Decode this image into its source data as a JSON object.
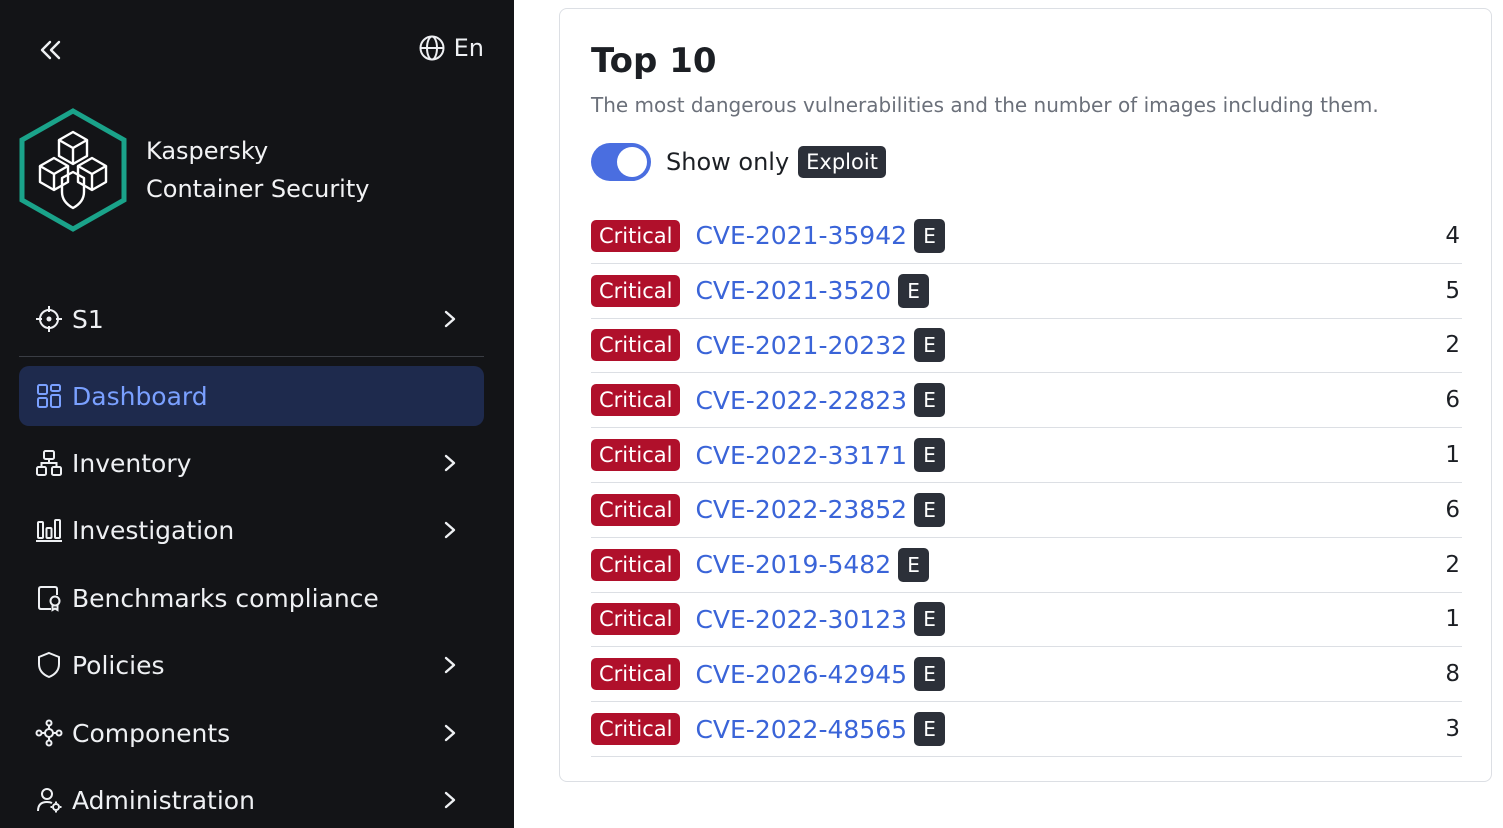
{
  "sidebar": {
    "language": "En",
    "brand_line1": "Kaspersky",
    "brand_line2": "Container Security",
    "scope": "S1",
    "items": [
      {
        "label": "Dashboard",
        "icon": "dashboard-icon",
        "active": true
      },
      {
        "label": "Inventory",
        "icon": "inventory-icon"
      },
      {
        "label": "Investigation",
        "icon": "investigation-icon"
      },
      {
        "label": "Benchmarks compliance",
        "icon": "benchmark-icon"
      },
      {
        "label": "Policies",
        "icon": "shield-icon"
      },
      {
        "label": "Components",
        "icon": "components-icon"
      },
      {
        "label": "Administration",
        "icon": "admin-icon"
      }
    ]
  },
  "card": {
    "title": "Top 10",
    "subtitle": "The most dangerous vulnerabilities and the number of images including them.",
    "toggle_label": "Show only",
    "toggle_on": true,
    "exploit_badge": "Exploit",
    "rows": [
      {
        "severity": "Critical",
        "cve": "CVE-2021-35942",
        "badge": "E",
        "count": "4"
      },
      {
        "severity": "Critical",
        "cve": "CVE-2021-3520",
        "badge": "E",
        "count": "5"
      },
      {
        "severity": "Critical",
        "cve": "CVE-2021-20232",
        "badge": "E",
        "count": "2"
      },
      {
        "severity": "Critical",
        "cve": "CVE-2022-22823",
        "badge": "E",
        "count": "6"
      },
      {
        "severity": "Critical",
        "cve": "CVE-2022-33171",
        "badge": "E",
        "count": "1"
      },
      {
        "severity": "Critical",
        "cve": "CVE-2022-23852",
        "badge": "E",
        "count": "6"
      },
      {
        "severity": "Critical",
        "cve": "CVE-2019-5482",
        "badge": "E",
        "count": "2"
      },
      {
        "severity": "Critical",
        "cve": "CVE-2022-30123",
        "badge": "E",
        "count": "1"
      },
      {
        "severity": "Critical",
        "cve": "CVE-2026-42945",
        "badge": "E",
        "count": "8"
      },
      {
        "severity": "Critical",
        "cve": "CVE-2022-48565",
        "badge": "E",
        "count": "3"
      }
    ]
  },
  "colors": {
    "sidebar_bg": "#131417",
    "active_bg": "#1e2a4d",
    "active_text": "#7aa0ff",
    "critical": "#b0102b",
    "link": "#3a64d8",
    "toggle": "#4a6ee0",
    "brand_teal": "#1aa38a"
  }
}
